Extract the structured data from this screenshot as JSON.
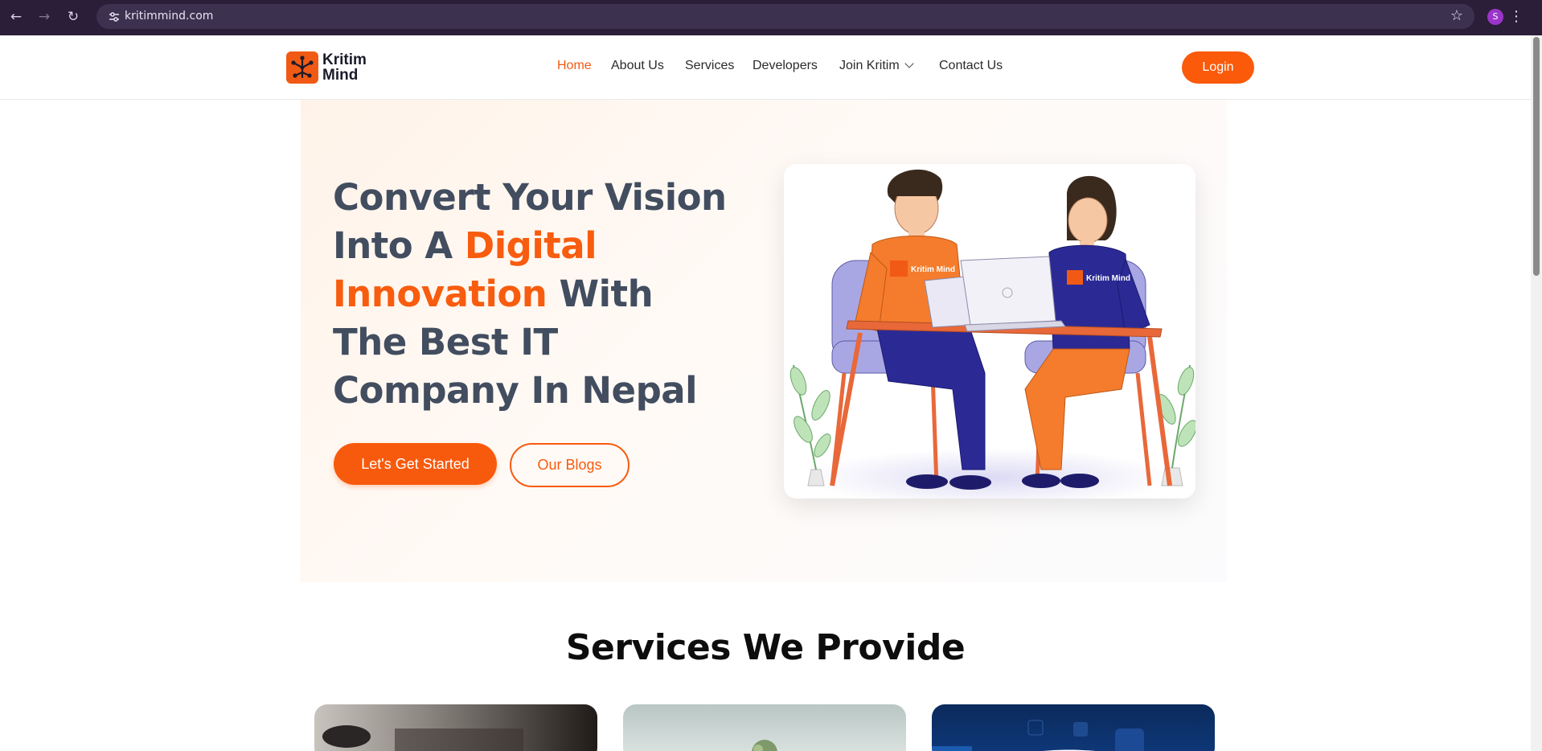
{
  "browser": {
    "url": "kritimmind.com",
    "profile_initial": "S"
  },
  "header": {
    "logo_text": "Kritim Mind",
    "nav": [
      {
        "label": "Home"
      },
      {
        "label": "About Us"
      },
      {
        "label": "Services"
      },
      {
        "label": "Developers"
      },
      {
        "label": "Join Kritim"
      },
      {
        "label": "Contact Us"
      }
    ],
    "login_label": "Login"
  },
  "hero": {
    "title_part1": "Convert Your Vision Into A ",
    "title_highlight": "Digital Innovation",
    "title_part2": " With The Best IT Company In Nepal",
    "cta_primary": "Let's Get Started",
    "cta_secondary": "Our Blogs",
    "illustration_shirt_text": "Kritim Mind"
  },
  "services": {
    "title": "Services We Provide"
  },
  "colors": {
    "brand": "#f85a0d",
    "heading": "#424d5f",
    "chrome": "#2b1e39"
  }
}
